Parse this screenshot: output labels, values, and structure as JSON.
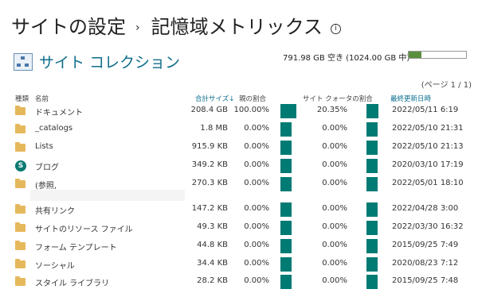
{
  "header": {
    "title": "サイトの設定",
    "separator": "›",
    "subtitle": "記憶域メトリックス",
    "info": "i"
  },
  "collection": {
    "label": "サイト コレクション",
    "quota_text": "791.98 GB 空き (1024.00 GB 中)",
    "quota_used_fraction": 0.227
  },
  "pagination": "(ページ 1 / 1)",
  "columns": {
    "type": "種類",
    "name": "名前",
    "total_size": "合計サイズ↓",
    "parent_pct": "親の割合",
    "quota_pct": "サイト クォータの割合",
    "modified": "最終更新日時"
  },
  "rows": [
    {
      "icon": "folder-icon",
      "name": "ドキュメント",
      "size": "208.4 GB",
      "parent": "100.00%",
      "parent_value": 100.0,
      "quota": "20.35%",
      "quota_value": 20.35,
      "modified": "2022/05/11 6:19"
    },
    {
      "icon": "folder-icon",
      "name": "_catalogs",
      "size": "1.8 MB",
      "parent": "0.00%",
      "parent_value": 0.0,
      "quota": "0.00%",
      "quota_value": 0.0,
      "modified": "2022/05/10 21:31"
    },
    {
      "icon": "folder-icon",
      "name": "Lists",
      "size": "915.9 KB",
      "parent": "0.00%",
      "parent_value": 0.0,
      "quota": "0.00%",
      "quota_value": 0.0,
      "modified": "2022/05/10 21:13"
    },
    {
      "icon": "sharepoint-site-icon",
      "name": "ブログ",
      "size": "349.2 KB",
      "parent": "0.00%",
      "parent_value": 0.0,
      "quota": "0.00%",
      "quota_value": 0.0,
      "modified": "2020/03/10 17:19"
    },
    {
      "icon": "folder-icon",
      "name": "(参照,",
      "size": "270.3 KB",
      "parent": "0.00%",
      "parent_value": 0.0,
      "quota": "0.00%",
      "quota_value": 0.0,
      "modified": "2022/05/01 18:10"
    },
    {
      "icon": "folder-icon",
      "name": "共有リンク",
      "size": "147.2 KB",
      "parent": "0.00%",
      "parent_value": 0.0,
      "quota": "0.00%",
      "quota_value": 0.0,
      "modified": "2022/04/28 3:00"
    },
    {
      "icon": "folder-icon",
      "name": "サイトのリソース ファイル",
      "size": "49.3 KB",
      "parent": "0.00%",
      "parent_value": 0.0,
      "quota": "0.00%",
      "quota_value": 0.0,
      "modified": "2022/03/30 16:32"
    },
    {
      "icon": "folder-icon",
      "name": "フォーム テンプレート",
      "size": "44.8 KB",
      "parent": "0.00%",
      "parent_value": 0.0,
      "quota": "0.00%",
      "quota_value": 0.0,
      "modified": "2015/09/25 7:49"
    },
    {
      "icon": "folder-icon",
      "name": "ソーシャル",
      "size": "34.4 KB",
      "parent": "0.00%",
      "parent_value": 0.0,
      "quota": "0.00%",
      "quota_value": 0.0,
      "modified": "2020/08/23 7:12"
    },
    {
      "icon": "folder-icon",
      "name": "スタイル ライブラリ",
      "size": "28.2 KB",
      "parent": "0.00%",
      "parent_value": 0.0,
      "quota": "0.00%",
      "quota_value": 0.0,
      "modified": "2015/09/25 7:48"
    }
  ]
}
